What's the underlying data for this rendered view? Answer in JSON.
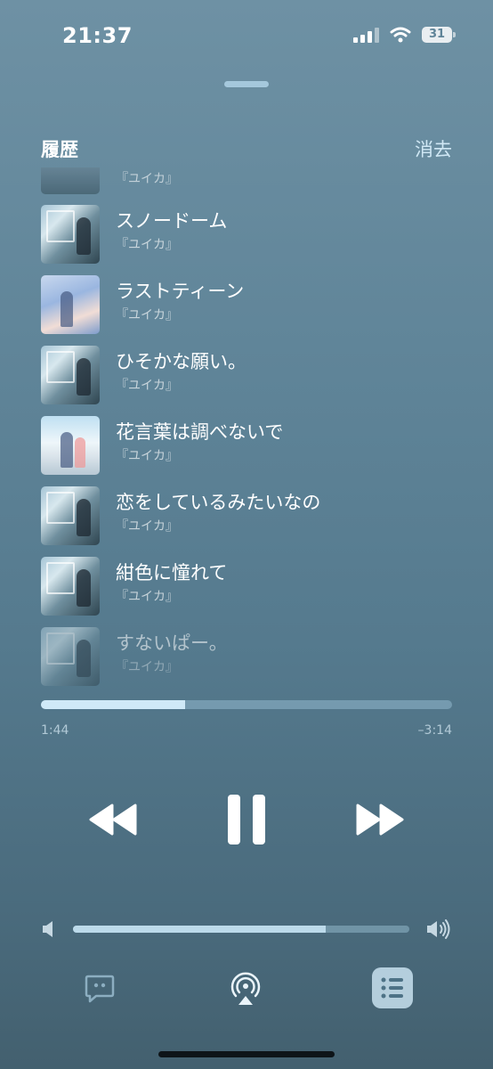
{
  "status": {
    "time": "21:37",
    "battery": "31"
  },
  "header": {
    "title": "履歴",
    "clear_label": "消去"
  },
  "history": {
    "cut_artist": "『ユイカ』",
    "items": [
      {
        "title": "スノードーム",
        "artist": "『ユイカ』"
      },
      {
        "title": "ラストティーン",
        "artist": "『ユイカ』"
      },
      {
        "title": "ひそかな願い。",
        "artist": "『ユイカ』"
      },
      {
        "title": "花言葉は調べないで",
        "artist": "『ユイカ』"
      },
      {
        "title": "恋をしているみたいなの",
        "artist": "『ユイカ』"
      },
      {
        "title": "紺色に憧れて",
        "artist": "『ユイカ』"
      },
      {
        "title": "すないぱー。",
        "artist": "『ユイカ』"
      }
    ]
  },
  "playback": {
    "elapsed": "1:44",
    "remaining": "–3:14",
    "progress_fraction": 0.35
  },
  "volume": {
    "level_fraction": 0.75
  },
  "colors": {
    "accent_light": "#cfe9f7",
    "background_top": "#6e91a4",
    "background_bottom": "#43606f"
  },
  "icons": {
    "lyrics": "quote-bubble-icon",
    "airplay": "airplay-icon",
    "queue": "list-icon",
    "rewind": "backward-icon",
    "pause": "pause-icon",
    "forward": "forward-icon"
  }
}
